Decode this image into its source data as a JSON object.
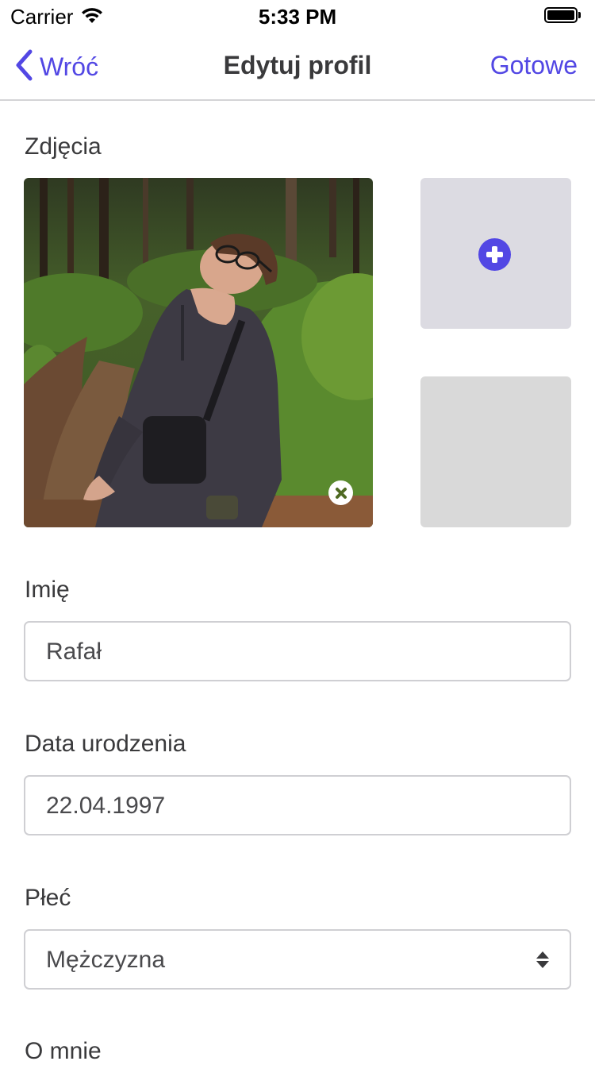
{
  "status_bar": {
    "carrier": "Carrier",
    "time": "5:33 PM"
  },
  "nav": {
    "back_label": "Wróć",
    "title": "Edytuj profil",
    "done_label": "Gotowe"
  },
  "photos": {
    "label": "Zdjęcia"
  },
  "form": {
    "name_label": "Imię",
    "name_value": "Rafał",
    "birthdate_label": "Data urodzenia",
    "birthdate_value": "22.04.1997",
    "gender_label": "Płeć",
    "gender_value": "Mężczyzna",
    "about_label": "O mnie"
  },
  "colors": {
    "accent": "#5247e4",
    "text": "#3a3a3c",
    "border": "#cfcfd3"
  }
}
